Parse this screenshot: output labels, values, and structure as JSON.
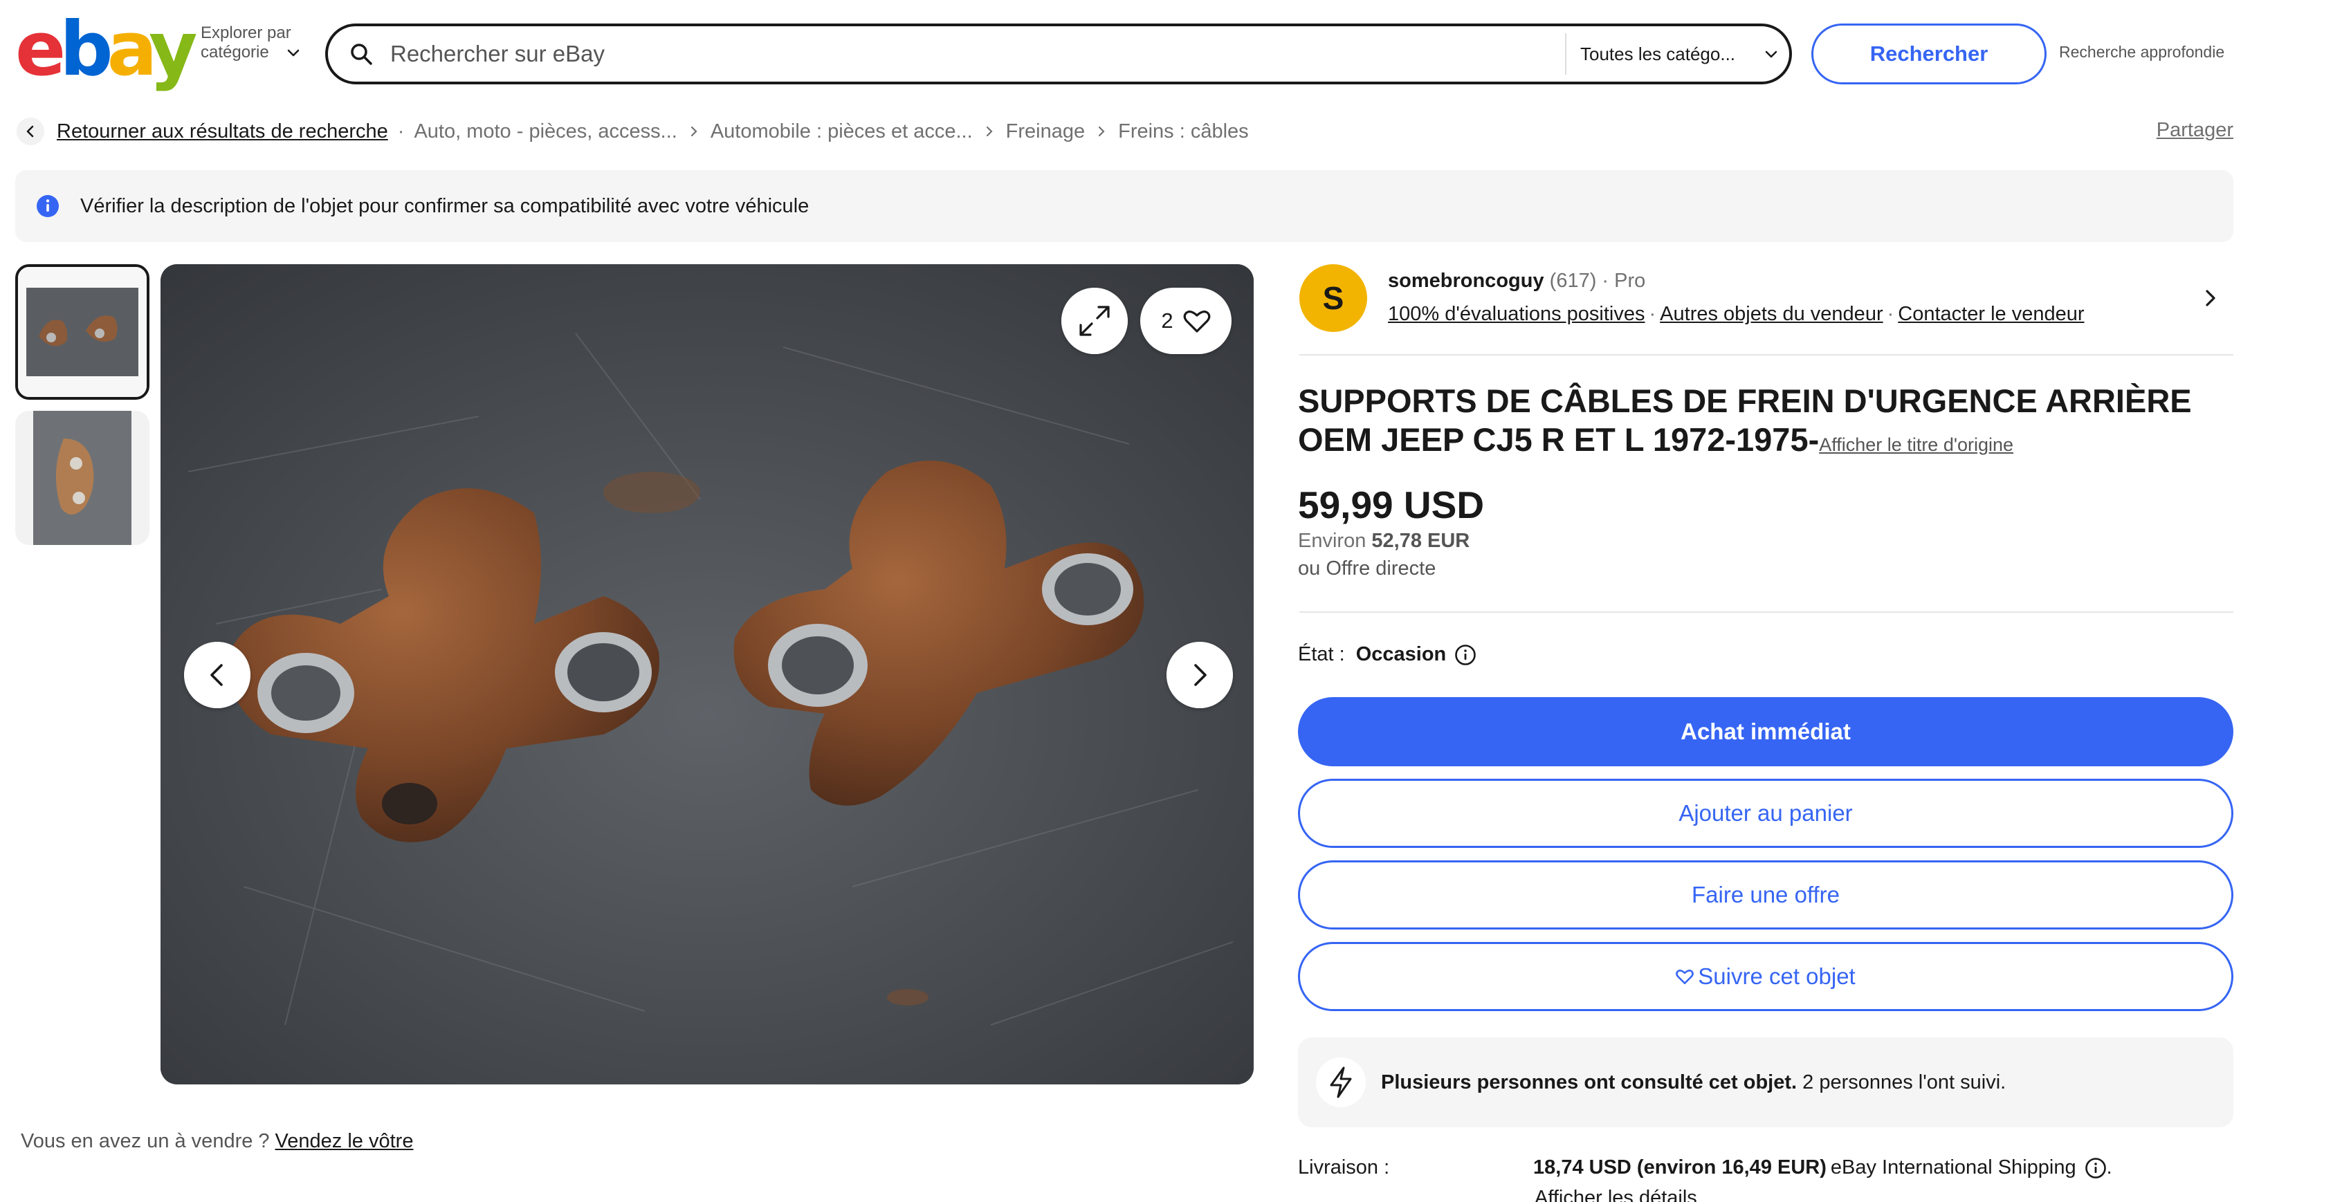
{
  "header": {
    "logo": {
      "e": "e",
      "b": "b",
      "a": "a",
      "y": "y"
    },
    "explore": "Explorer par catégorie",
    "search": {
      "placeholder": "Rechercher sur eBay",
      "value": ""
    },
    "category": "Toutes les catégo...",
    "search_button": "Rechercher",
    "advanced": "Recherche approfondie"
  },
  "breadcrumb": {
    "back": "Retourner aux résultats de recherche",
    "items": [
      "Auto, moto - pièces, access...",
      "Automobile : pièces et acce...",
      "Freinage",
      "Freins : câbles"
    ],
    "share": "Partager"
  },
  "banner": {
    "text": "Vérifier la description de l'objet pour confirmer sa compatibilité avec votre véhicule"
  },
  "gallery": {
    "watch_count": "2"
  },
  "sell": {
    "question": "Vous en avez un à vendre ?",
    "link": "Vendez le vôtre"
  },
  "seller": {
    "initial": "S",
    "name": "somebroncoguy",
    "count": "(617)",
    "type": "Pro",
    "positive": "100% d'évaluations positives",
    "other_items": "Autres objets du vendeur",
    "contact": "Contacter le vendeur"
  },
  "item": {
    "title": "SUPPORTS DE CÂBLES DE FREIN D'URGENCE ARRIÈRE OEM JEEP CJ5 R ET L 1972-1975-",
    "original_title": "Afficher le titre d'origine",
    "price": "59,99 USD",
    "approx_prefix": "Environ",
    "approx_value": "52,78 EUR",
    "best_offer": "ou Offre directe",
    "condition_label": "État :",
    "condition_value": "Occasion"
  },
  "actions": {
    "buy_now": "Achat immédiat",
    "add_cart": "Ajouter au panier",
    "make_offer": "Faire une offre",
    "watch": "Suivre cet objet"
  },
  "popularity": {
    "bold": "Plusieurs personnes ont consulté cet objet.",
    "rest": "2 personnes l'ont suivi."
  },
  "shipping": {
    "label": "Livraison :",
    "cost": "18,74 USD (environ 16,49 EUR)",
    "service": "eBay International Shipping",
    "suffix": ".",
    "details": "Afficher les détails"
  },
  "colors": {
    "accent": "#3665f3",
    "avatar": "#f2b400",
    "text": "#191919",
    "muted": "#707070"
  }
}
